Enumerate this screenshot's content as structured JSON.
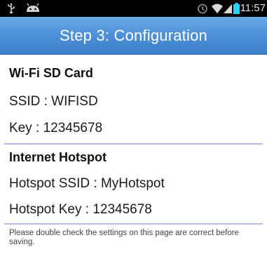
{
  "status_bar": {
    "time": "11:57",
    "icons": [
      "usb-icon",
      "android-icon",
      "alarm-icon",
      "wifi-icon",
      "signal-icon",
      "battery-icon"
    ],
    "accent_color": "#2bd2ff"
  },
  "action_bar": {
    "title": "Step 3: Configuration",
    "color": "#4b8ed6"
  },
  "wifi_sd": {
    "heading": "Wi-Fi SD Card",
    "ssid": "SSID : WIFISD",
    "key": "Key : 12345678"
  },
  "hotspot": {
    "heading": "Internet Hotspot",
    "ssid": "Hotspot SSID : MyHotspot",
    "key": "Hotspot Key : 12345678"
  },
  "note": "Please double check the settings on this page are correct before saving."
}
